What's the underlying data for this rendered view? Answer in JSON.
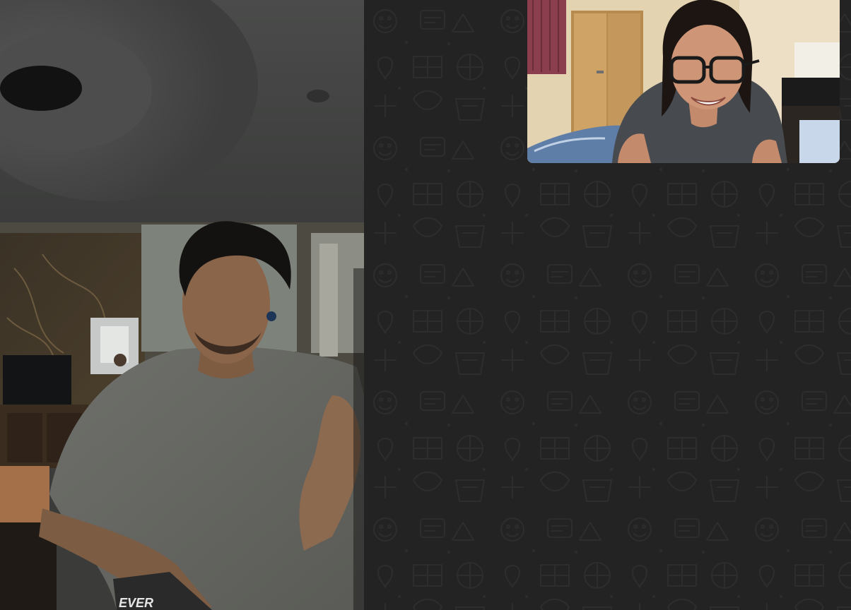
{
  "app": {
    "kind": "video-call"
  },
  "main_video": {
    "participant": "remote-participant",
    "shirt_text": "EVER"
  },
  "self_view": {
    "participant": "local-participant"
  },
  "wallpaper": {
    "pattern": "doodle-icons",
    "background_color": "#232323",
    "doodle_color": "#2c2c2c"
  }
}
